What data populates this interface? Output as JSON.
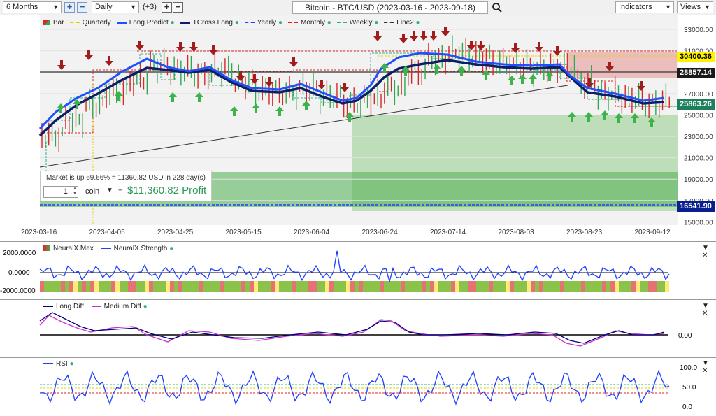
{
  "toolbar": {
    "period": "6 Months",
    "interval": "Daily",
    "extra": "(+3)",
    "title": "Bitcoin - BTC/USD (2023-03-16 - 2023-09-18)",
    "indicators": "Indicators",
    "views": "Views"
  },
  "legend_main": [
    {
      "label": "Bar",
      "color": "#d62828"
    },
    {
      "label": "Quarterly",
      "color": "#e6d100"
    },
    {
      "label": "Long.Predict",
      "color": "#1f4fff"
    },
    {
      "label": "TCross.Long",
      "color": "#0b1f66"
    },
    {
      "label": "Yearly",
      "color": "#1f3fff"
    },
    {
      "label": "Monthly",
      "color": "#e02020"
    },
    {
      "label": "Weekly",
      "color": "#2fb08a"
    },
    {
      "label": "Line2",
      "color": "#333333"
    }
  ],
  "y_axis": [
    "33000.00",
    "31000.00",
    "29000.00",
    "27000.00",
    "25000.00",
    "23000.00",
    "21000.00",
    "19000.00",
    "17000.00",
    "15000.00"
  ],
  "x_axis": [
    "2023-03-16",
    "2023-04-05",
    "2023-04-25",
    "2023-05-15",
    "2023-06-04",
    "2023-06-24",
    "2023-07-14",
    "2023-08-03",
    "2023-08-23",
    "2023-09-12"
  ],
  "price_tags": [
    {
      "value": "30400.36",
      "bg": "#fff200",
      "fg": "#000000"
    },
    {
      "value": "28857.14",
      "bg": "#1a1a1a",
      "fg": "#ffffff"
    },
    {
      "value": "25863.26",
      "bg": "#1e7f5c",
      "fg": "#ffffff"
    },
    {
      "value": "16541.90",
      "bg": "#0a1f8f",
      "fg": "#ffffff"
    }
  ],
  "summary": {
    "text": "Market is up 69.66% = 11360.82 USD in 228 day(s)",
    "qty": "1",
    "unit": "coin",
    "equals": "=",
    "profit": "$11,360.82 Profit"
  },
  "neural": {
    "legend": [
      "NeuralX.Max",
      "NeuralX.Strength"
    ],
    "y_axis": [
      "2000.0000",
      "0.0000",
      "-2000.0000"
    ]
  },
  "diff": {
    "legend": [
      "Long.Diff",
      "Medium.Diff"
    ],
    "y_axis": [
      "0.00"
    ]
  },
  "rsi": {
    "legend": [
      "RSI"
    ],
    "y_axis": [
      "100.0",
      "50.0",
      "0.0"
    ]
  }
}
